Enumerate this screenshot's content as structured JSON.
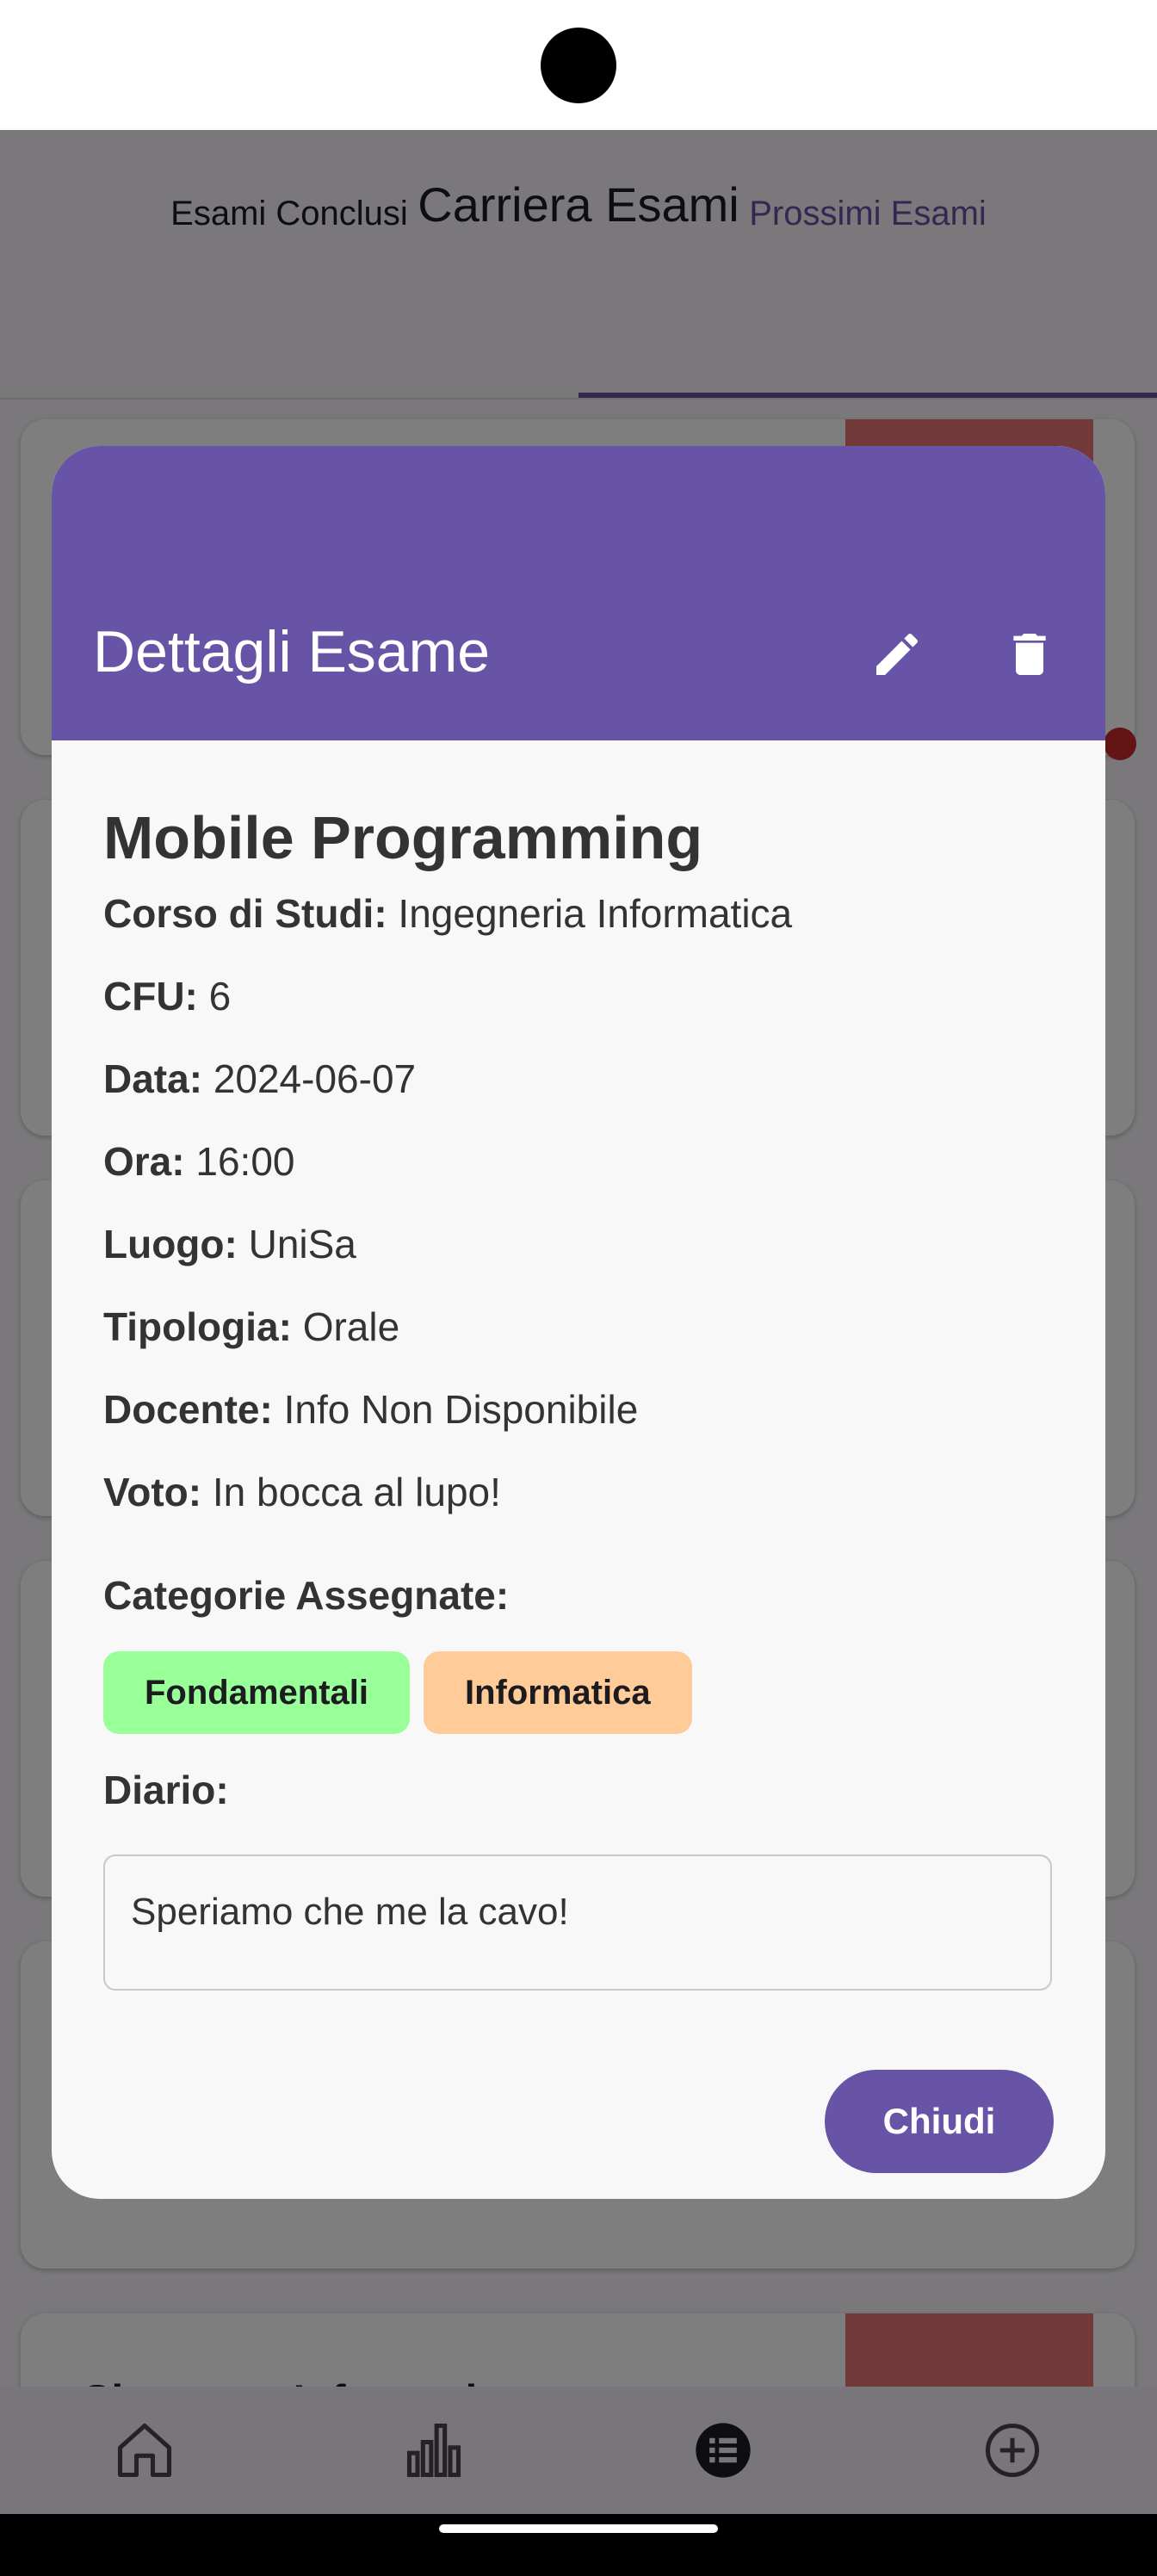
{
  "app": {
    "title": "Carriera Esami",
    "tabs": [
      {
        "label": "Esami Conclusi",
        "selected": false
      },
      {
        "label": "Prossimi Esami",
        "selected": true
      }
    ],
    "background_cards": [
      {
        "title": "Sicurezza Informatica"
      }
    ],
    "accent_color": "#6750a4"
  },
  "bottom_nav": {
    "items": [
      {
        "icon": "home-icon"
      },
      {
        "icon": "bar-chart-icon"
      },
      {
        "icon": "list-icon",
        "selected": true
      },
      {
        "icon": "add-circle-icon"
      }
    ]
  },
  "dialog": {
    "header_title": "Dettagli Esame",
    "header_color": "#6854a6",
    "edit_icon": "pencil-icon",
    "delete_icon": "trash-icon",
    "exam_name": "Mobile Programming",
    "fields": [
      {
        "label": "Corso di Studi:",
        "value": "Ingegneria Informatica"
      },
      {
        "label": "CFU:",
        "value": "6"
      },
      {
        "label": "Data:",
        "value": "2024-06-07"
      },
      {
        "label": "Ora:",
        "value": "16:00"
      },
      {
        "label": "Luogo:",
        "value": "UniSa"
      },
      {
        "label": "Tipologia:",
        "value": "Orale"
      },
      {
        "label": "Docente:",
        "value": "Info Non Disponibile"
      },
      {
        "label": "Voto:",
        "value": "In bocca al lupo!"
      }
    ],
    "categories_label": "Categorie Assegnate:",
    "categories": [
      {
        "label": "Fondamentali",
        "color": "#99ff99"
      },
      {
        "label": "Informatica",
        "color": "#ffcc99"
      }
    ],
    "diary_label": "Diario:",
    "diary_text": "Speriamo che me la cavo!",
    "close_label": "Chiudi"
  }
}
